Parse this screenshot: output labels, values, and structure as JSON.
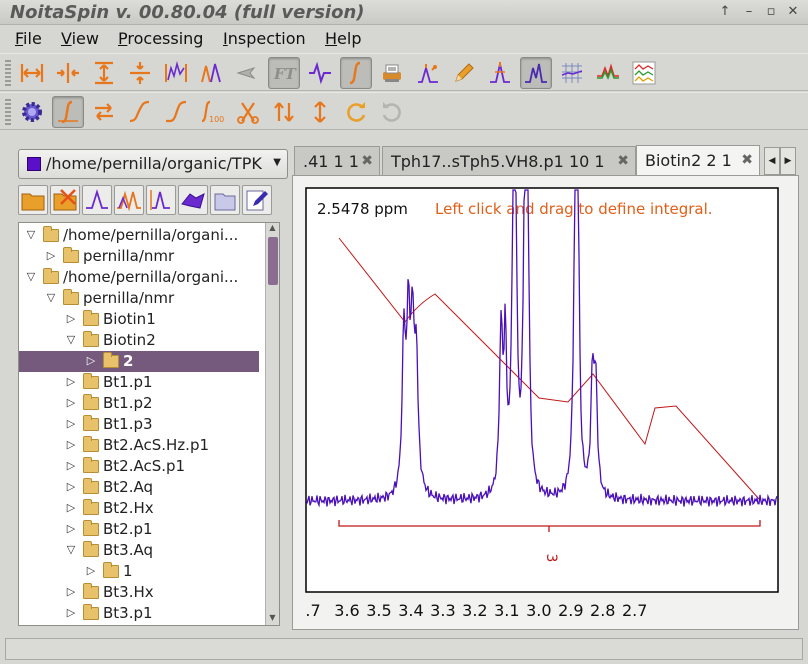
{
  "window": {
    "title": "NoitaSpin v. 00.80.04 (full version)"
  },
  "menus": [
    {
      "key": "F",
      "rest": "ile"
    },
    {
      "key": "V",
      "rest": "iew"
    },
    {
      "key": "P",
      "rest": "rocessing"
    },
    {
      "key": "I",
      "rest": "nspection"
    },
    {
      "key": "H",
      "rest": "elp"
    }
  ],
  "file_browser": {
    "path": "/home/pernilla/organic/TPK",
    "tree": [
      {
        "label": "/home/pernilla/organi...",
        "depth": 0,
        "state": "open"
      },
      {
        "label": "pernilla/nmr",
        "depth": 1,
        "state": "closed"
      },
      {
        "label": "/home/pernilla/organi...",
        "depth": 0,
        "state": "open"
      },
      {
        "label": "pernilla/nmr",
        "depth": 1,
        "state": "open"
      },
      {
        "label": "Biotin1",
        "depth": 2,
        "state": "closed"
      },
      {
        "label": "Biotin2",
        "depth": 2,
        "state": "open"
      },
      {
        "label": "2",
        "depth": 3,
        "state": "closed",
        "selected": true
      },
      {
        "label": "Bt1.p1",
        "depth": 2,
        "state": "closed"
      },
      {
        "label": "Bt1.p2",
        "depth": 2,
        "state": "closed"
      },
      {
        "label": "Bt1.p3",
        "depth": 2,
        "state": "closed"
      },
      {
        "label": "Bt2.AcS.Hz.p1",
        "depth": 2,
        "state": "closed"
      },
      {
        "label": "Bt2.AcS.p1",
        "depth": 2,
        "state": "closed"
      },
      {
        "label": "Bt2.Aq",
        "depth": 2,
        "state": "closed"
      },
      {
        "label": "Bt2.Hx",
        "depth": 2,
        "state": "closed"
      },
      {
        "label": "Bt2.p1",
        "depth": 2,
        "state": "closed"
      },
      {
        "label": "Bt3.Aq",
        "depth": 2,
        "state": "open"
      },
      {
        "label": "1",
        "depth": 3,
        "state": "closed"
      },
      {
        "label": "Bt3.Hx",
        "depth": 2,
        "state": "closed"
      },
      {
        "label": "Bt3.p1",
        "depth": 2,
        "state": "closed"
      }
    ]
  },
  "tabs": [
    {
      "label": ".41 1 1",
      "active": false
    },
    {
      "label": "Tph17..sTph5.VH8.p1 10 1",
      "active": false
    },
    {
      "label": "Biotin2 2 1",
      "active": true
    }
  ],
  "spectrum": {
    "cursor_readout": "2.5478 ppm",
    "hint": "Left click and drag to define integral.",
    "integral_value": "3",
    "x_ticks": [
      ".7",
      "3.6",
      "3.5",
      "3.4",
      "3.3",
      "3.2",
      "3.1",
      "3.0",
      "2.9",
      "2.8",
      "2.7"
    ],
    "spectrum_color": "#4a10b8",
    "integral_color": "#c01818",
    "hint_color": "#e0601a"
  }
}
